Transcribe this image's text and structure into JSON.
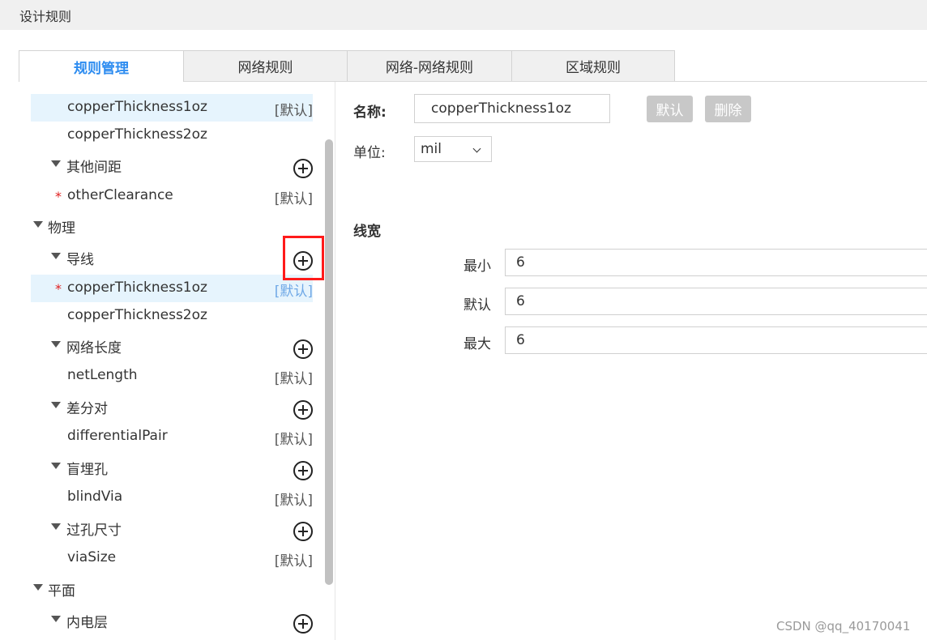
{
  "title": "设计规则",
  "tabs": [
    {
      "label": "规则管理",
      "active": true
    },
    {
      "label": "网络规则",
      "active": false
    },
    {
      "label": "网络-网络规则",
      "active": false
    },
    {
      "label": "区域规则",
      "active": false
    }
  ],
  "tree": {
    "rows": [
      {
        "text": "copperThickness1oz",
        "tag": "[默认]",
        "selected": true
      },
      {
        "text": "copperThickness2oz"
      },
      {
        "text": "其他间距",
        "group": true
      },
      {
        "text": "otherClearance",
        "tag": "[默认]",
        "required": "*"
      },
      {
        "text": "物理",
        "category": true
      },
      {
        "text": "导线",
        "group": true
      },
      {
        "text": "copperThickness1oz",
        "tag": "[默认]",
        "required": "*",
        "selected": true
      },
      {
        "text": "copperThickness2oz"
      },
      {
        "text": "网络长度",
        "group": true
      },
      {
        "text": "netLength",
        "tag": "[默认]"
      },
      {
        "text": "差分对",
        "group": true
      },
      {
        "text": "differentialPair",
        "tag": "[默认]"
      },
      {
        "text": "盲埋孔",
        "group": true
      },
      {
        "text": "blindVia",
        "tag": "[默认]"
      },
      {
        "text": "过孔尺寸",
        "group": true
      },
      {
        "text": "viaSize",
        "tag": "[默认]"
      },
      {
        "text": "平面",
        "category": true
      },
      {
        "text": "内电层",
        "group": true
      }
    ]
  },
  "form": {
    "name_label": "名称:",
    "name_value": "copperThickness1oz",
    "default_button": "默认",
    "delete_button": "删除",
    "unit_label": "单位:",
    "unit_value": "mil",
    "section_title": "线宽",
    "min_label": "最小",
    "min_value": "6",
    "default_label": "默认",
    "default_value": "6",
    "max_label": "最大",
    "max_value": "6"
  },
  "watermark": "CSDN @qq_40170041",
  "colors": {
    "accent": "#2d8cf0",
    "selected_bg": "#e6f4fd",
    "highlight_box": "#ff1a1a",
    "required": "#e02020"
  }
}
